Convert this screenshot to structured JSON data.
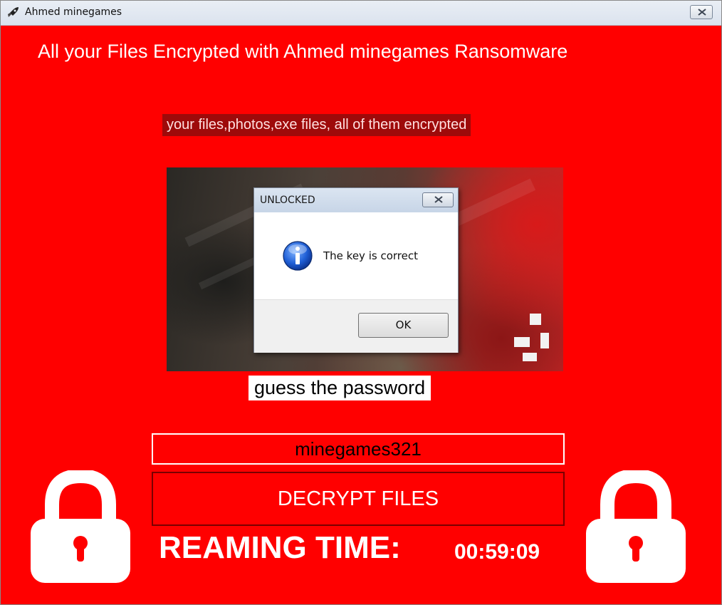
{
  "window": {
    "title": "Ahmed minegames",
    "background_color": "#ff0000",
    "icons": [
      "rocket-app-icon",
      "close-icon"
    ]
  },
  "main": {
    "headline": "All your Files Encrypted with Ahmed minegames Ransomware",
    "subtitle": "your files,photos,exe files, all of them encrypted",
    "password_prompt": "guess the password",
    "key_input_value": "minegames321",
    "decrypt_button_label": "DECRYPT FILES",
    "timer_label": "REAMING TIME:",
    "timer_value": "00:59:09",
    "icons": [
      "padlock-icon",
      "padlock-icon"
    ]
  },
  "dialog": {
    "title": "UNLOCKED",
    "message": "The key is correct",
    "ok_label": "OK",
    "icons": [
      "info-icon",
      "close-icon"
    ]
  }
}
